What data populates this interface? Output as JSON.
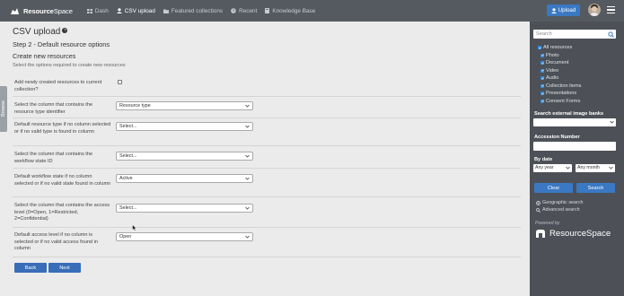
{
  "header": {
    "logo_text_bold": "Resource",
    "logo_text_thin": "Space",
    "nav": [
      {
        "label": "Dash",
        "icon": "dash-icon"
      },
      {
        "label": "CSV upload",
        "icon": "user-icon"
      },
      {
        "label": "Featured collections",
        "icon": "folder-icon"
      },
      {
        "label": "Recent",
        "icon": "clock-icon"
      },
      {
        "label": "Knowledge Base",
        "icon": "book-icon"
      }
    ],
    "upload_label": "Upload"
  },
  "browse_tab": {
    "label": "Browse"
  },
  "page": {
    "title": "CSV upload",
    "help_glyph": "?",
    "step": "Step 2 - Default resource options",
    "section": "Create new resources",
    "description": "Select the options required to create new resources"
  },
  "rows": [
    {
      "label": "Add newly created resources to current collection?",
      "control": "checkbox",
      "checked": false
    },
    {
      "label": "Select the column that contains the resource type identifier",
      "control": "select",
      "value": "Resource type"
    },
    {
      "label": "Default resource type if no column selected or if no valid type is found in column",
      "control": "select",
      "value": "Select..."
    },
    {
      "label": "Select the column that contains the workflow state ID",
      "control": "select",
      "value": "Select..."
    },
    {
      "label": "Default workflow state if no column selected or if no valid state found in column",
      "control": "select",
      "value": "Active"
    },
    {
      "label": "Select the column that contains the access level (0=Open, 1=Restricted, 2=Confidential)",
      "control": "select",
      "value": "Select..."
    },
    {
      "label": "Default access level if no column is selected or if no valid access found in column",
      "control": "select",
      "value": "Open"
    }
  ],
  "buttons": {
    "back": "Back",
    "next": "Next"
  },
  "sidebar": {
    "search_placeholder": "Search",
    "filters": [
      "All resources",
      "Photo",
      "Document",
      "Video",
      "Audio",
      "Collection items",
      "Presentations",
      "Consent Forms"
    ],
    "external_label": "Search external image banks",
    "external_value": "",
    "accession_label": "Accession Number",
    "bydate_label": "By date",
    "year_value": "Any year",
    "month_value": "Any month",
    "clear_label": "Clear",
    "search_label": "Search",
    "geo_link": "Geographic search",
    "advanced_link": "Advanced search",
    "powered_by": "Powered by",
    "brand": "ResourceSpace"
  },
  "colors": {
    "header_bg": "#555a60",
    "sidebar_bg": "#4d5157",
    "accent": "#3a78c3",
    "main_bg": "#ebebeb"
  }
}
